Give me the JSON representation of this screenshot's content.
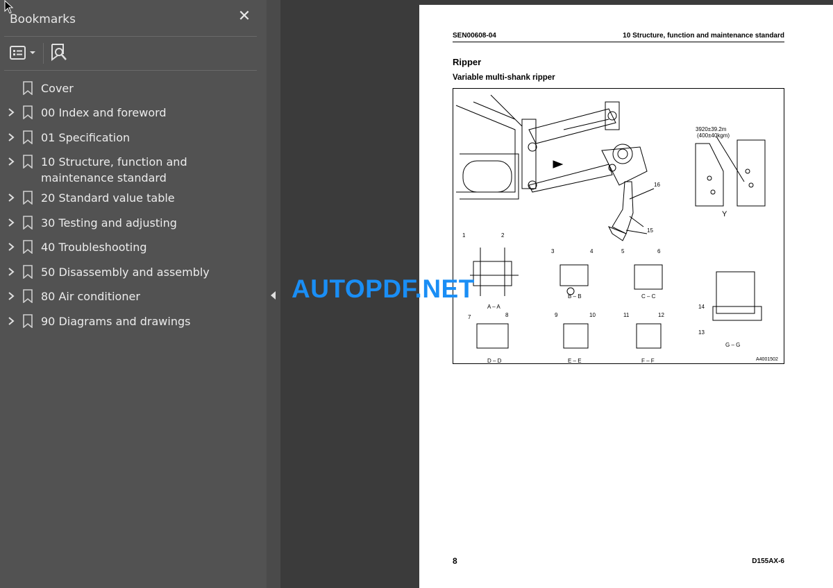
{
  "sidebar": {
    "title": "Bookmarks",
    "close_icon": "close-icon",
    "options_icon": "list-options-icon",
    "find_icon": "find-bookmark-icon",
    "items": [
      {
        "label": "Cover",
        "expandable": false
      },
      {
        "label": "00 Index and foreword",
        "expandable": true
      },
      {
        "label": "01 Specification",
        "expandable": true
      },
      {
        "label": "10 Structure, function and maintenance standard",
        "expandable": true
      },
      {
        "label": "20 Standard value table",
        "expandable": true
      },
      {
        "label": "30 Testing and adjusting",
        "expandable": true
      },
      {
        "label": "40 Troubleshooting",
        "expandable": true
      },
      {
        "label": "50 Disassembly and assembly",
        "expandable": true
      },
      {
        "label": "80 Air conditioner",
        "expandable": true
      },
      {
        "label": "90 Diagrams and drawings",
        "expandable": true
      }
    ]
  },
  "page": {
    "header_left": "SEN00608-04",
    "header_right": "10 Structure, function and maintenance standard",
    "title": "Ripper",
    "subtitle": "Variable multi-shank ripper",
    "page_number": "8",
    "model": "D155AX-6",
    "figure": {
      "code": "A4001502",
      "callout_numbers": [
        "1",
        "2",
        "3",
        "4",
        "5",
        "6",
        "7",
        "8",
        "9",
        "10",
        "11",
        "12",
        "13",
        "14",
        "15",
        "16"
      ],
      "view_y_label": "Y",
      "torque_line1": "3920±39.2m",
      "torque_line2": "(400±40kgm)",
      "section_labels": [
        "A – A",
        "B – B",
        "C – C",
        "D – D",
        "E – E",
        "F – F",
        "G – G"
      ]
    }
  },
  "watermark": "AUTOPDF.NET",
  "colors": {
    "sidebar_bg": "#525252",
    "viewer_bg": "#3b3b3b",
    "watermark": "#1a8ef5"
  }
}
